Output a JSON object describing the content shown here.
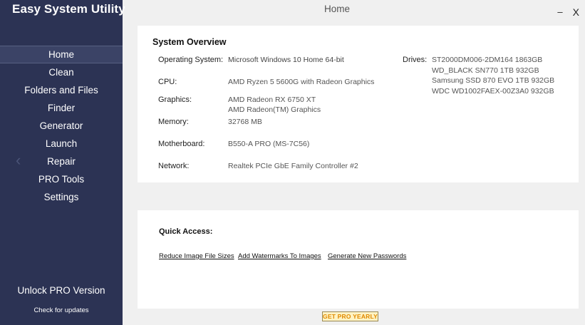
{
  "app": {
    "title": "Easy System Utility"
  },
  "sidebar": {
    "items": [
      {
        "label": "Home",
        "active": true
      },
      {
        "label": "Clean"
      },
      {
        "label": "Folders and Files"
      },
      {
        "label": "Finder"
      },
      {
        "label": "Generator"
      },
      {
        "label": "Launch"
      },
      {
        "label": "Repair"
      },
      {
        "label": "PRO Tools"
      },
      {
        "label": "Settings"
      }
    ],
    "unlock_label": "Unlock PRO Version",
    "updates_label": "Check for updates",
    "collapse_icon": "chevron-left-icon",
    "background": "#2c3354"
  },
  "header": {
    "title": "Home",
    "minimize": "–",
    "close": "X"
  },
  "overview": {
    "title": "System Overview",
    "os_label": "Operating System:",
    "os_value": "Microsoft Windows 10 Home 64-bit",
    "cpu_label": "CPU:",
    "cpu_value": "AMD Ryzen 5 5600G with Radeon Graphics",
    "graphics_label": "Graphics:",
    "graphics_values": [
      "AMD Radeon RX 6750 XT",
      "AMD Radeon(TM) Graphics"
    ],
    "memory_label": "Memory:",
    "memory_value": "32768 MB",
    "motherboard_label": "Motherboard:",
    "motherboard_value": "B550-A PRO (MS-7C56)",
    "network_label": "Network:",
    "network_value": "Realtek PCIe GbE Family Controller #2",
    "drives_label": "Drives:",
    "drives": [
      "ST2000DM006-2DM164 1863GB",
      "WD_BLACK SN770 1TB 932GB",
      "Samsung SSD 870 EVO 1TB 932GB",
      "WDC WD1002FAEX-00Z3A0 932GB"
    ]
  },
  "quick_access": {
    "title": "Quick Access:",
    "links": [
      "Reduce Image File Sizes",
      "Add Watermarks To Images",
      "Generate New Passwords"
    ]
  },
  "footer": {
    "pro_button": "GET PRO YEARLY"
  }
}
